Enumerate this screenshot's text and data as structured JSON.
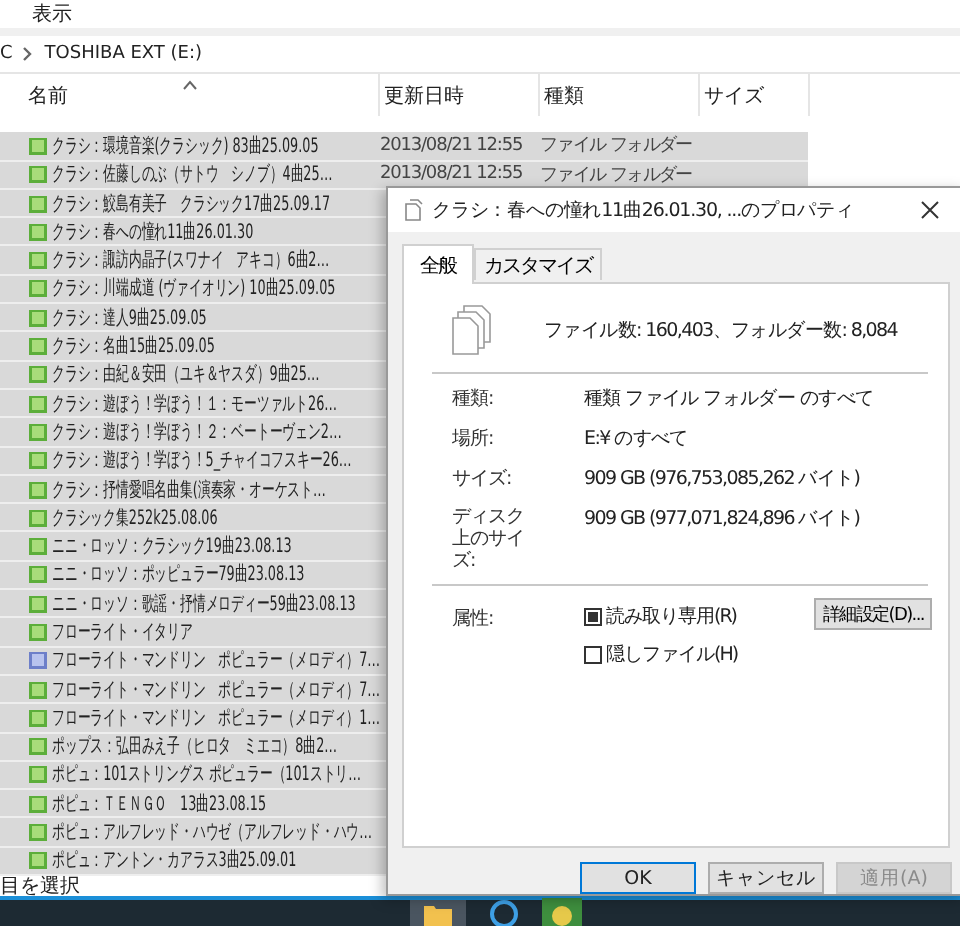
{
  "menu": {
    "label": "表示"
  },
  "address": {
    "parts": [
      "C",
      "TOSHIBA EXT (E:)"
    ]
  },
  "table": {
    "columns": [
      {
        "label": "名前",
        "sorted": true
      },
      {
        "label": "更新日時",
        "sorted": false
      },
      {
        "label": "種類",
        "sorted": false
      },
      {
        "label": "サイズ",
        "sorted": false
      }
    ],
    "rows": [
      {
        "name": "クラシ：環境音楽(クラシック) 83曲25.09.05",
        "date": "2013/08/21 12:55",
        "type": "ファイル フォルダー",
        "kind": "music",
        "selected": true
      },
      {
        "name": "クラシ：佐藤しのぶ（サトウ　シノブ）4曲25…",
        "date": "2013/08/21 12:55",
        "type": "ファイル フォルダー",
        "kind": "music",
        "selected": true
      },
      {
        "name": "クラシ：鮫島有美子　クラシック17曲25.09.17",
        "kind": "music",
        "selected": true
      },
      {
        "name": "クラシ：春への憧れ11曲26.01.30",
        "kind": "music",
        "selected": true
      },
      {
        "name": "クラシ：諏訪内晶子(スワナイ　アキコ）6曲2…",
        "kind": "music",
        "selected": true
      },
      {
        "name": "クラシ：川端成道 (ヴァイオリン) 10曲25.09.05",
        "kind": "music",
        "selected": true
      },
      {
        "name": "クラシ：達人9曲25.09.05",
        "kind": "music",
        "selected": true
      },
      {
        "name": "クラシ：名曲15曲25.09.05",
        "kind": "music",
        "selected": true
      },
      {
        "name": "クラシ：由紀＆安田（ユキ＆ヤスダ）9曲25…",
        "kind": "music",
        "selected": true
      },
      {
        "name": "クラシ：遊ぼう！学ぼう！１：モーツァルト26…",
        "kind": "music",
        "selected": true
      },
      {
        "name": "クラシ：遊ぼう！学ぼう！２：ベートーヴェン2…",
        "kind": "music",
        "selected": true
      },
      {
        "name": "クラシ：遊ぼう！学ぼう！5_チャイコフスキー26…",
        "kind": "music",
        "selected": true
      },
      {
        "name": "クラシ：抒情愛唱名曲集(演奏家・オーケスト…",
        "kind": "music",
        "selected": true
      },
      {
        "name": "クラシック集252k25.08.06",
        "kind": "music",
        "selected": true
      },
      {
        "name": "ニニ・ロッソ：クラシック19曲23.08.13",
        "kind": "music",
        "selected": true
      },
      {
        "name": "ニニ・ロッソ：ポッピュラー79曲23.08.13",
        "kind": "music",
        "selected": true
      },
      {
        "name": "ニニ・ロッソ：歌謡・抒情メロディー59曲23.08.13",
        "kind": "music",
        "selected": true
      },
      {
        "name": "フローライト・イタリア",
        "kind": "music",
        "selected": true
      },
      {
        "name": "フローライト・マンドリン　ポピュラー（メロディ）7…",
        "kind": "plain",
        "selected": true
      },
      {
        "name": "フローライト・マンドリン　ポピュラー（メロディ）7…",
        "kind": "music",
        "selected": true
      },
      {
        "name": "フローライト・マンドリン　ポピュラー（メロディ）1…",
        "kind": "music",
        "selected": true
      },
      {
        "name": "ポップス：弘田みえ子（ヒロタ　ミエコ）8曲2…",
        "kind": "music",
        "selected": true
      },
      {
        "name": "ポピュ：101ストリングス ポピュラー（101ストリ…",
        "kind": "music",
        "selected": true
      },
      {
        "name": "ポピュ：ＴＥＮＧＯ　13曲23.08.15",
        "kind": "music",
        "selected": true
      },
      {
        "name": "ポピュ：アルフレッド・ハウゼ（アルフレッド・ハウ…",
        "kind": "music",
        "selected": true
      },
      {
        "name": "ポピュ：アントン・カアラス3曲25.09.01",
        "kind": "music",
        "selected": true
      }
    ]
  },
  "status_bar": "目を選択",
  "dialog": {
    "title": "クラシ：春への憧れ11曲26.01.30, ...のプロパティ",
    "tabs": [
      {
        "label": "全般",
        "selected": true
      },
      {
        "label": "カスタマイズ",
        "selected": false
      }
    ],
    "summary": "ファイル数: 160,403、フォルダー数: 8,084",
    "fields": [
      {
        "label": "種類:",
        "value": "種類 ファイル フォルダー のすべて"
      },
      {
        "label": "場所:",
        "value": "E:¥ のすべて"
      },
      {
        "label": "サイズ:",
        "value": "909 GB (976,753,085,262 バイト)"
      },
      {
        "label": "ディスク上のサイズ:",
        "value": "909 GB (977,071,824,896 バイト)"
      }
    ],
    "attributes_label": "属性:",
    "attributes": [
      {
        "label": "読み取り専用(R)",
        "checked": true
      },
      {
        "label": "隠しファイル(H)",
        "checked": false
      }
    ],
    "advanced_button": "詳細設定(D)...",
    "buttons": [
      {
        "label": "OK",
        "disabled": false,
        "default": true
      },
      {
        "label": "キャンセル",
        "disabled": false,
        "default": false
      },
      {
        "label": "適用(A)",
        "disabled": true,
        "default": false
      }
    ]
  }
}
